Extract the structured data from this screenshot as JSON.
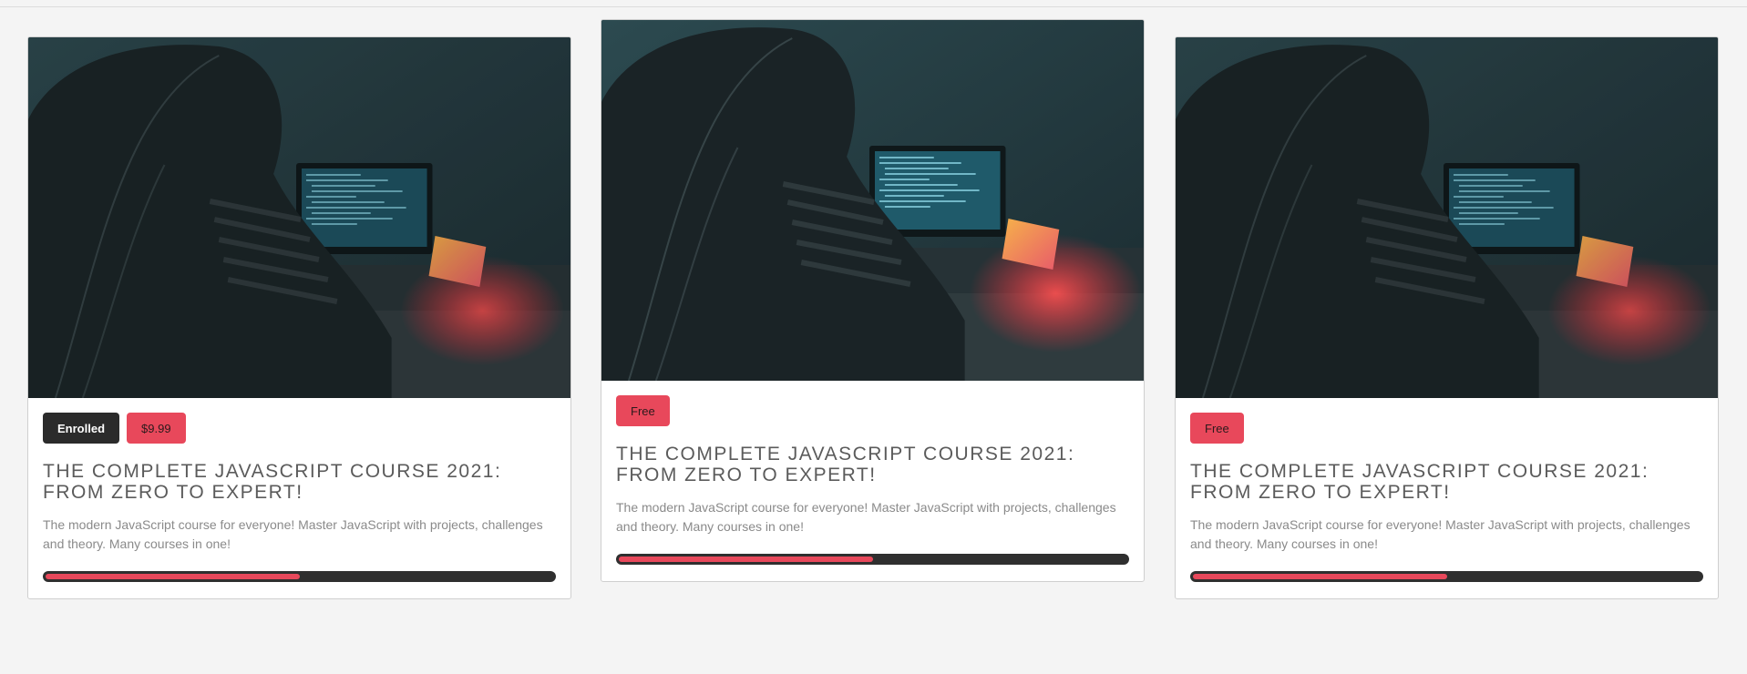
{
  "cards": [
    {
      "badges": {
        "enrolled": "Enrolled",
        "price": "$9.99"
      },
      "title_line1": "THE COMPLETE JAVASCRIPT COURSE 2021:",
      "title_line2": "FROM ZERO TO EXPERT!",
      "description_line1": "The modern JavaScript course for everyone! Master JavaScript with projects, challenges",
      "description_line2": "and theory. Many courses in one!",
      "progress_percent": 50
    },
    {
      "badges": {
        "price": "Free"
      },
      "title_line1": "THE COMPLETE JAVASCRIPT COURSE 2021:",
      "title_line2": "FROM ZERO TO EXPERT!",
      "description_line1": "The modern JavaScript course for everyone! Master JavaScript with projects, challenges",
      "description_line2": "and theory. Many courses in one!",
      "progress_percent": 50
    },
    {
      "badges": {
        "price": "Free"
      },
      "title_line1": "THE COMPLETE JAVASCRIPT COURSE 2021:",
      "title_line2": "FROM ZERO TO EXPERT!",
      "description_line1": "The modern JavaScript course for everyone! Master JavaScript with projects, challenges",
      "description_line2": "and theory. Many courses in one!",
      "progress_percent": 50
    }
  ],
  "colors": {
    "accent": "#e8485b",
    "dark": "#2b2b2b",
    "card_background": "#ffffff",
    "page_background": "#f4f4f4"
  }
}
